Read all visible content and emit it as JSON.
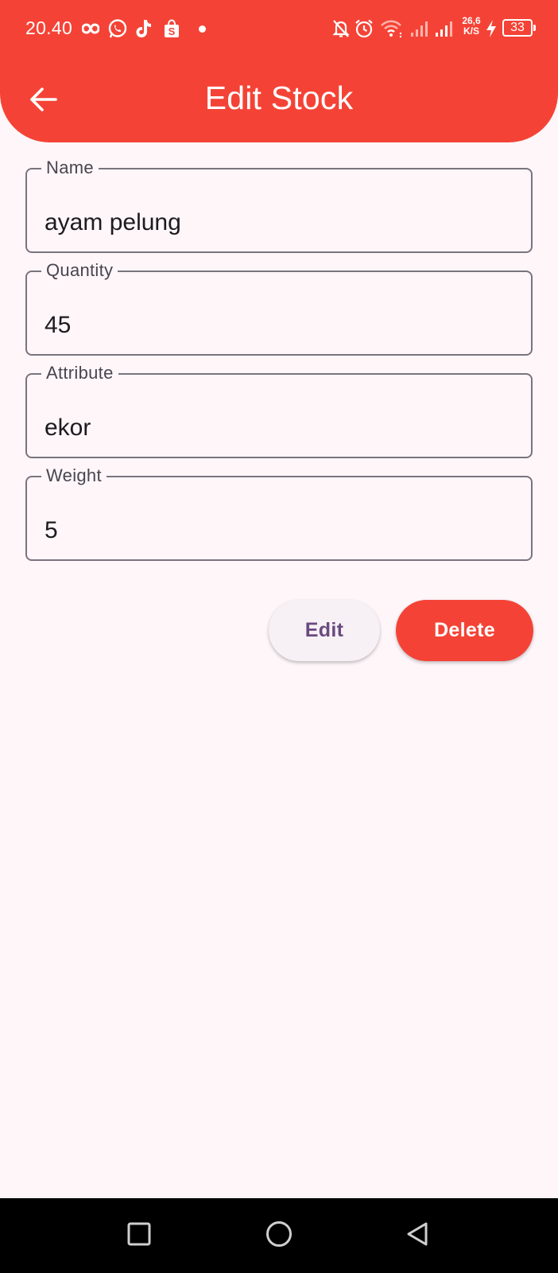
{
  "status_bar": {
    "time": "20.40",
    "network_speed_value": "26,6",
    "network_speed_unit": "K/S",
    "battery_level": "33",
    "left_icons": [
      "infinity-icon",
      "whatsapp-icon",
      "tiktok-icon",
      "shopee-bag-icon",
      "notification-dot"
    ],
    "right_icons": [
      "bell-off-icon",
      "alarm-icon",
      "wifi-icon",
      "signal-weak-icon",
      "signal-icon",
      "charging-bolt-icon",
      "battery-icon"
    ]
  },
  "app_bar": {
    "title": "Edit Stock",
    "back_icon": "arrow-left-icon"
  },
  "form": {
    "fields": [
      {
        "label": "Name",
        "value": "ayam pelung"
      },
      {
        "label": "Quantity",
        "value": "45"
      },
      {
        "label": "Attribute",
        "value": "ekor"
      },
      {
        "label": "Weight",
        "value": "5"
      }
    ]
  },
  "actions": {
    "edit_label": "Edit",
    "delete_label": "Delete"
  },
  "nav_bar": {
    "buttons": [
      "recents-square-icon",
      "home-circle-icon",
      "back-triangle-icon"
    ]
  },
  "colors": {
    "primary": "#f44336",
    "background": "#fef6f9",
    "outline": "#79747e",
    "edit_text": "#6a4a80"
  }
}
